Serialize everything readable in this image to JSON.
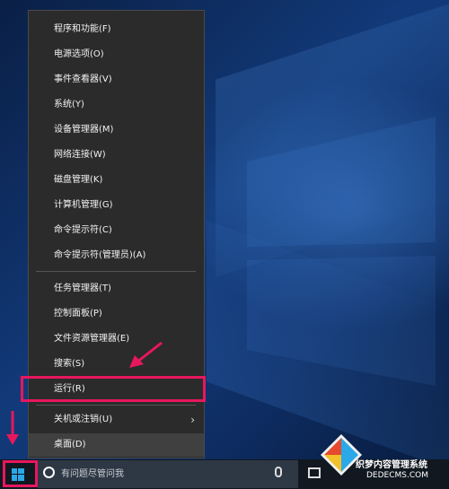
{
  "menu": {
    "items": [
      {
        "label": "程序和功能(F)"
      },
      {
        "label": "电源选项(O)"
      },
      {
        "label": "事件查看器(V)"
      },
      {
        "label": "系统(Y)"
      },
      {
        "label": "设备管理器(M)"
      },
      {
        "label": "网络连接(W)"
      },
      {
        "label": "磁盘管理(K)"
      },
      {
        "label": "计算机管理(G)"
      },
      {
        "label": "命令提示符(C)"
      },
      {
        "label": "命令提示符(管理员)(A)"
      },
      {
        "label": "任务管理器(T)"
      },
      {
        "label": "控制面板(P)"
      },
      {
        "label": "文件资源管理器(E)"
      },
      {
        "label": "搜索(S)"
      },
      {
        "label": "运行(R)"
      },
      {
        "label": "关机或注销(U)"
      },
      {
        "label": "桌面(D)"
      }
    ]
  },
  "taskbar": {
    "search_placeholder": "有问题尽管问我"
  },
  "watermark": {
    "line1": "织梦内容管理系统",
    "line2": "DEDECMS.COM"
  },
  "colors": {
    "highlight": "#e8175d",
    "menu_bg": "#2b2b2b",
    "windows_logo": "#2ba8e8"
  },
  "icons": [
    "windows-logo-icon",
    "cortana-icon",
    "microphone-icon",
    "task-view-icon",
    "chevron-right-icon"
  ]
}
